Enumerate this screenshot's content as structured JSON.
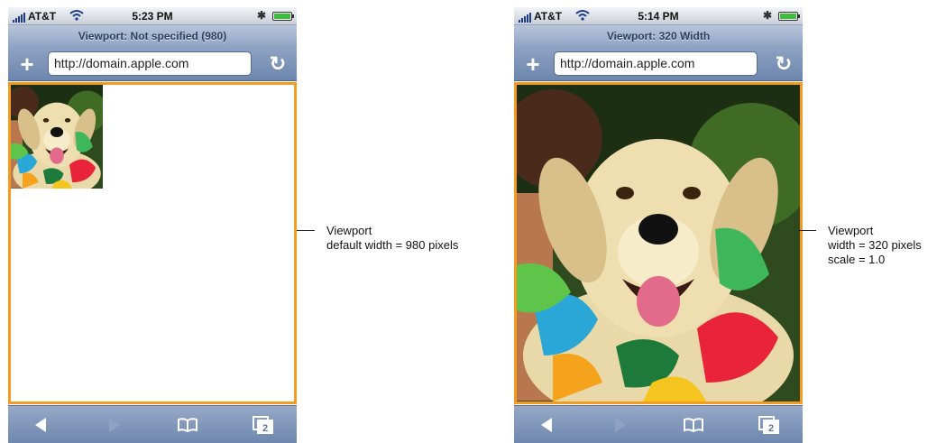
{
  "phones": [
    {
      "status": {
        "carrier": "AT&T",
        "time": "5:23 PM"
      },
      "title": "Viewport: Not specified (980)",
      "url": "http://domain.apple.com",
      "callout": {
        "line1": "Viewport",
        "line2": "default width = 980 pixels",
        "line3": ""
      }
    },
    {
      "status": {
        "carrier": "AT&T",
        "time": "5:14 PM"
      },
      "title": "Viewport: 320 Width",
      "url": "http://domain.apple.com",
      "callout": {
        "line1": "Viewport",
        "line2": "width = 320 pixels",
        "line3": "scale = 1.0"
      }
    }
  ],
  "toolbar": {
    "pages_count": "2"
  },
  "colors": {
    "viewport_border": "#f39c1f",
    "nav_blue": "#6d86ad"
  },
  "icons": [
    "signal-icon",
    "wifi-icon",
    "bluetooth-icon",
    "battery-icon",
    "add-bookmark-icon",
    "reload-icon",
    "back-icon",
    "forward-icon",
    "bookmarks-icon",
    "pages-icon"
  ]
}
